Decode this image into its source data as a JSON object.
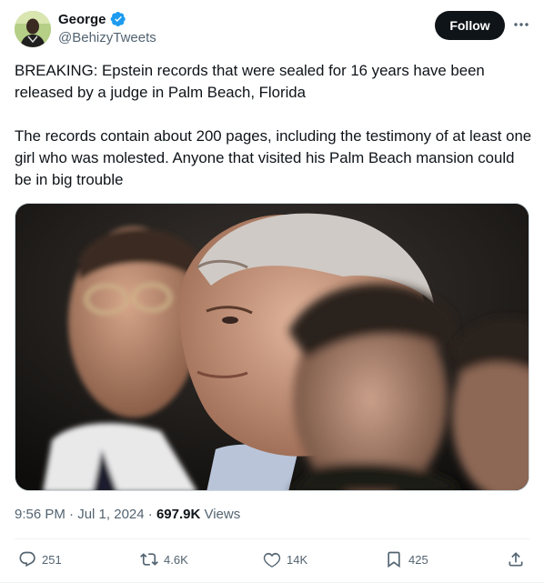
{
  "author": {
    "display_name": "George",
    "handle": "@BehizyTweets",
    "verified_color": "#1d9bf0"
  },
  "header": {
    "follow_label": "Follow",
    "more_icon": "more-horizontal-icon"
  },
  "tweet": {
    "text": "BREAKING: Epstein records that were sealed for 16 years have been released by a judge in Palm Beach, Florida\n\nThe records contain about 200 pages, including the testimony of at least one girl who was molested. Anyone that visited his Palm Beach mansion could be in big trouble"
  },
  "meta": {
    "time": "9:56 PM",
    "separator": " · ",
    "date": "Jul 1, 2024",
    "views_count": "697.9K",
    "views_label": " Views"
  },
  "actions": {
    "replies": "251",
    "retweets": "4.6K",
    "likes": "14K",
    "bookmarks": "425"
  },
  "colors": {
    "text_primary": "#0f1419",
    "text_secondary": "#536471",
    "follow_bg": "#0f1419",
    "border": "#eff3f4"
  }
}
